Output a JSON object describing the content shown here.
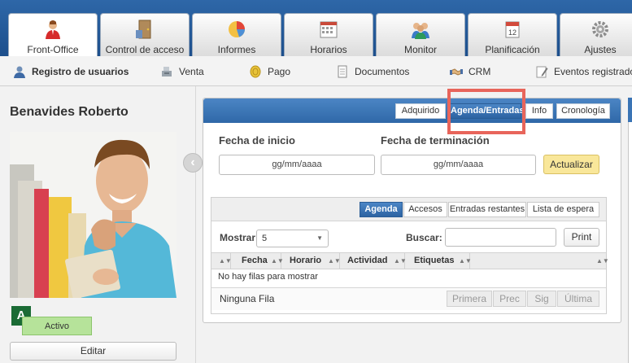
{
  "top_tabs": [
    {
      "label": "Front-Office",
      "icon": "user-red-icon"
    },
    {
      "label": "Control de acceso",
      "icon": "door-icon"
    },
    {
      "label": "Informes",
      "icon": "pie-chart-icon"
    },
    {
      "label": "Horarios",
      "icon": "calendar-grid-icon"
    },
    {
      "label": "Monitor",
      "icon": "group-icon"
    },
    {
      "label": "Planificación",
      "icon": "calendar-icon"
    },
    {
      "label": "Ajustes",
      "icon": "gear-icon"
    }
  ],
  "sub_nav": [
    {
      "label": "Registro de usuarios",
      "icon": "user-icon"
    },
    {
      "label": "Venta",
      "icon": "cash-register-icon"
    },
    {
      "label": "Pago",
      "icon": "coin-icon"
    },
    {
      "label": "Documentos",
      "icon": "document-icon"
    },
    {
      "label": "CRM",
      "icon": "handshake-icon"
    },
    {
      "label": "Eventos registrados",
      "icon": "pencil-icon"
    }
  ],
  "profile": {
    "name": "Benavides Roberto",
    "badge": "A",
    "status": "Activo",
    "edit_label": "Editar"
  },
  "header_tabs": [
    "Adquirido",
    "Agenda/Entradas",
    "Info",
    "Cronología"
  ],
  "form": {
    "start_label": "Fecha de inicio",
    "end_label": "Fecha de terminación",
    "start_placeholder": "gg/mm/aaaa",
    "end_placeholder": "gg/mm/aaaa",
    "update_label": "Actualizar"
  },
  "inner_tabs": [
    "Agenda",
    "Accesos",
    "Entradas restantes",
    "Lista de espera"
  ],
  "table": {
    "show_label": "Mostrar",
    "show_value": "5",
    "search_label": "Buscar:",
    "print_label": "Print",
    "columns": [
      "Fecha",
      "Horario",
      "Actividad",
      "Etiquetas"
    ],
    "empty_message": "No hay filas para mostrar",
    "footer_label": "Ninguna Fila",
    "pagination": [
      "Primera",
      "Prec",
      "Sig",
      "Última"
    ]
  },
  "colors": {
    "accent": "#2f68a8",
    "highlight": "#e8655b",
    "status_bg": "#b6e39a",
    "update_bg": "#f9e79a"
  }
}
